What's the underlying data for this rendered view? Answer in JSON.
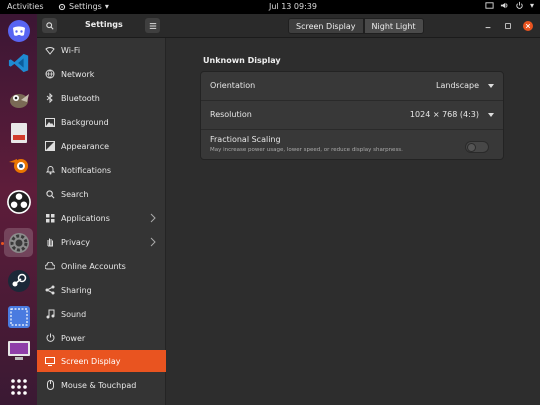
{
  "topbar": {
    "activities": "Activities",
    "app_name": "Settings",
    "clock": "Jul 13  09:39"
  },
  "header": {
    "title": "Settings",
    "tabs": [
      {
        "label": "Screen Display",
        "selected": true
      },
      {
        "label": "Night Light",
        "selected": false
      }
    ]
  },
  "dock": {
    "items": [
      "discord",
      "vscode",
      "gimp",
      "blender",
      "obs",
      "settings",
      "steam",
      "screenshot",
      "remote",
      "app-grid"
    ]
  },
  "sidebar": {
    "items": [
      {
        "label": "Wi-Fi",
        "icon": "wifi-icon"
      },
      {
        "label": "Network",
        "icon": "network-icon"
      },
      {
        "label": "Bluetooth",
        "icon": "bluetooth-icon"
      },
      {
        "label": "Background",
        "icon": "background-icon"
      },
      {
        "label": "Appearance",
        "icon": "appearance-icon"
      },
      {
        "label": "Notifications",
        "icon": "bell-icon"
      },
      {
        "label": "Search",
        "icon": "search-icon"
      },
      {
        "label": "Applications",
        "icon": "apps-icon",
        "chevron": true
      },
      {
        "label": "Privacy",
        "icon": "hand-icon",
        "chevron": true
      },
      {
        "label": "Online Accounts",
        "icon": "cloud-icon"
      },
      {
        "label": "Sharing",
        "icon": "share-icon"
      },
      {
        "label": "Sound",
        "icon": "music-note-icon"
      },
      {
        "label": "Power",
        "icon": "power-icon"
      },
      {
        "label": "Screen Display",
        "icon": "display-icon",
        "selected": true
      },
      {
        "label": "Mouse & Touchpad",
        "icon": "mouse-icon"
      }
    ]
  },
  "content": {
    "panel_title": "Unknown Display",
    "orientation": {
      "label": "Orientation",
      "value": "Landscape"
    },
    "resolution": {
      "label": "Resolution",
      "value": "1024 × 768 (4:3)"
    },
    "fractional": {
      "label": "Fractional Scaling",
      "description": "May increase power usage, lower speed, or reduce display sharpness.",
      "enabled": false
    }
  },
  "colors": {
    "accent": "#e95420"
  }
}
